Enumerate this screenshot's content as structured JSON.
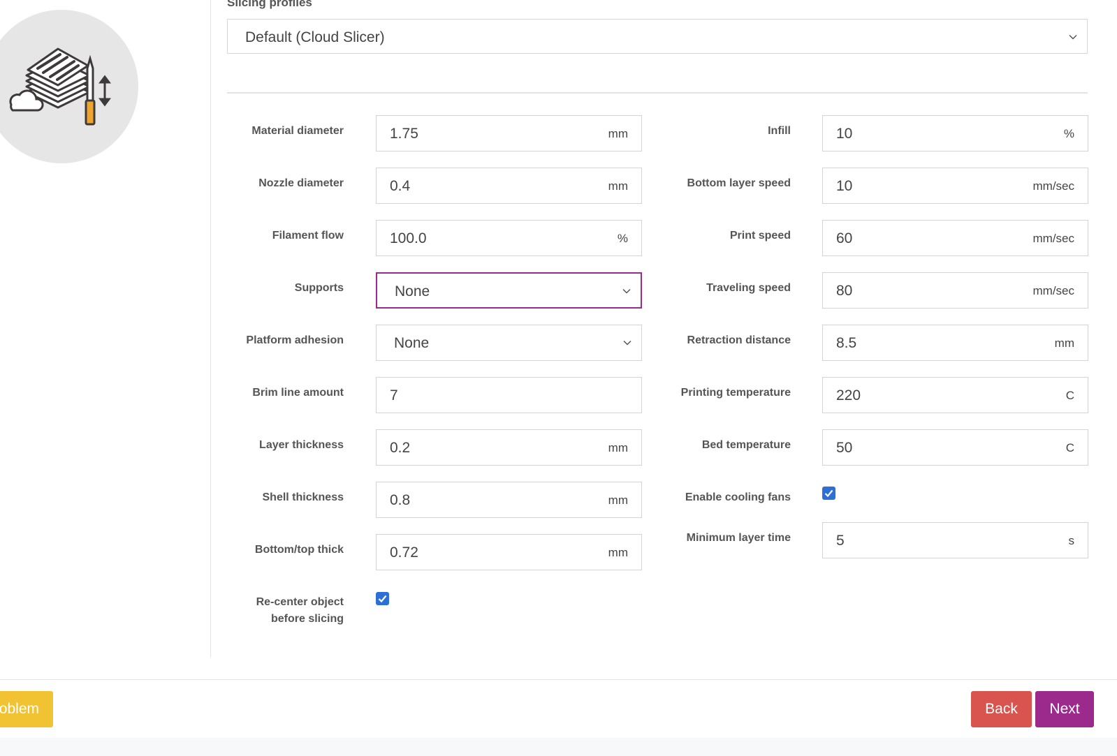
{
  "slicing_profiles": {
    "label": "Slicing profiles",
    "selected": "Default (Cloud Slicer)"
  },
  "left_fields": [
    {
      "label": "Material diameter",
      "value": "1.75",
      "unit": "mm"
    },
    {
      "label": "Nozzle diameter",
      "value": "0.4",
      "unit": "mm"
    },
    {
      "label": "Filament flow",
      "value": "100.0",
      "unit": "%"
    },
    {
      "label": "Supports",
      "value": "None",
      "type": "select"
    },
    {
      "label": "Platform adhesion",
      "value": "None",
      "type": "select"
    },
    {
      "label": "Brim line amount",
      "value": "7",
      "unit": ""
    },
    {
      "label": "Layer thickness",
      "value": "0.2",
      "unit": "mm"
    },
    {
      "label": "Shell thickness",
      "value": "0.8",
      "unit": "mm"
    },
    {
      "label": "Bottom/top thick",
      "value": "0.72",
      "unit": "mm"
    }
  ],
  "recenter": {
    "label_line1": "Re-center object",
    "label_line2": "before slicing",
    "checked": true
  },
  "right_fields": [
    {
      "label": "Infill",
      "value": "10",
      "unit": "%"
    },
    {
      "label": "Bottom layer speed",
      "value": "10",
      "unit": "mm/sec"
    },
    {
      "label": "Print speed",
      "value": "60",
      "unit": "mm/sec"
    },
    {
      "label": "Traveling speed",
      "value": "80",
      "unit": "mm/sec"
    },
    {
      "label": "Retraction distance",
      "value": "8.5",
      "unit": "mm"
    },
    {
      "label": "Printing temperature",
      "value": "220",
      "unit": "C"
    },
    {
      "label": "Bed temperature",
      "value": "50",
      "unit": "C"
    }
  ],
  "cooling_fans": {
    "label": "Enable cooling fans",
    "checked": true
  },
  "min_layer_time": {
    "label": "Minimum layer time",
    "value": "5",
    "unit": "s"
  },
  "footer": {
    "problem_label": "oblem",
    "back_label": "Back",
    "next_label": "Next"
  },
  "colors": {
    "accent": "#9b2a8c",
    "back": "#d9534f",
    "problem": "#f1c232",
    "checkbox": "#2d6fd6"
  },
  "icons": {
    "logo": "cloud-slicer-icon",
    "dropdown": "chevron-down-icon",
    "check": "check-icon"
  }
}
